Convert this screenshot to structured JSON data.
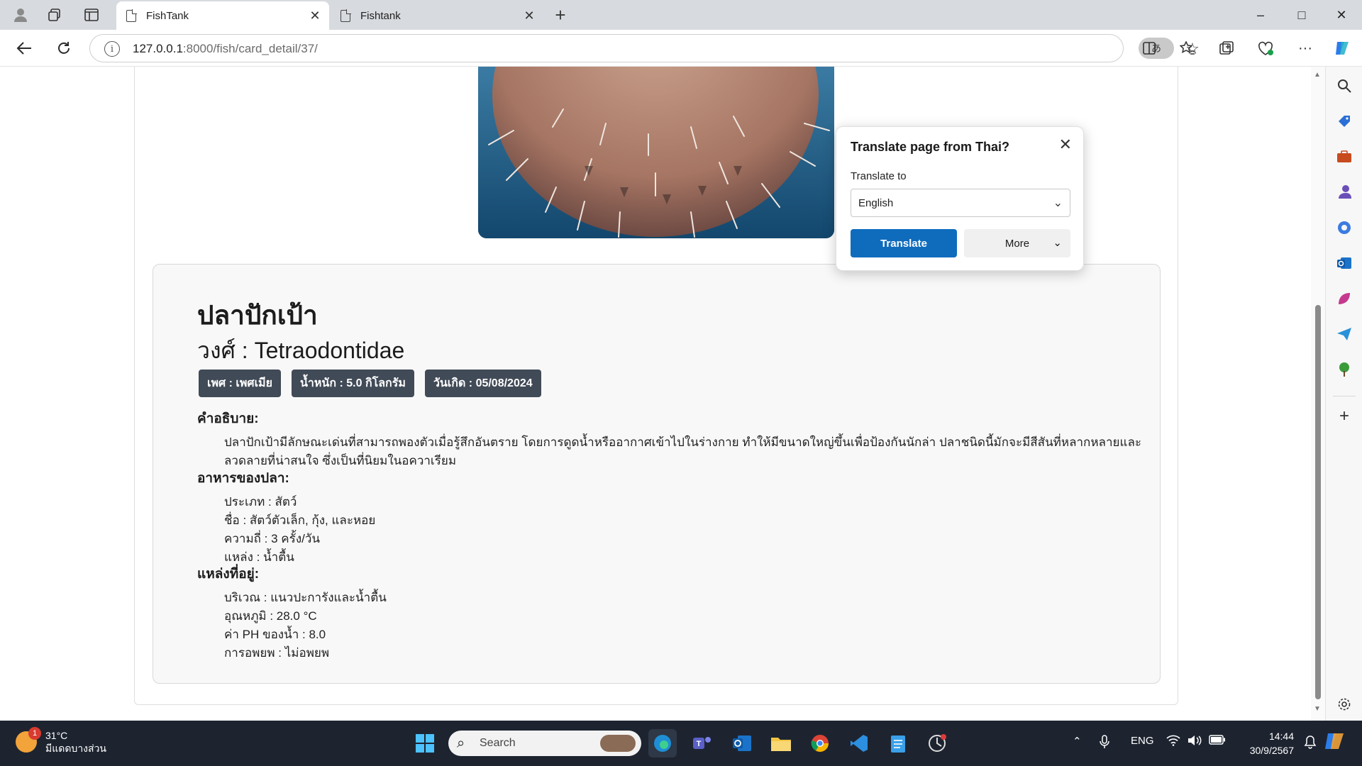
{
  "browser": {
    "tabs": [
      {
        "title": "FishTank",
        "active": true
      },
      {
        "title": "Fishtank",
        "active": false
      }
    ],
    "url_host": "127.0.0.1",
    "url_path": ":8000/fish/card_detail/37/",
    "translate_pill": "あ",
    "window_controls": {
      "minimize": "–",
      "maximize": "□",
      "close": "✕"
    }
  },
  "translate_popup": {
    "title": "Translate page from Thai?",
    "translate_to_label": "Translate to",
    "language": "English",
    "translate_button": "Translate",
    "more_button": "More"
  },
  "fish": {
    "name": "ปลาปักเป้า",
    "family": "วงศ์ : Tetraodontidae",
    "badges": [
      "เพศ : เพศเมีย",
      "น้ำหนัก : 5.0 กิโลกรัม",
      "วันเกิด : 05/08/2024"
    ],
    "description_title": "คำอธิบาย:",
    "description_lines": [
      "ปลาปักเป้ามีลักษณะเด่นที่สามารถพองตัวเมื่อรู้สึกอันตราย โดยการดูดน้ำหรืออากาศเข้าไปในร่างกาย ทำให้มีขนาดใหญ่ขึ้นเพื่อป้องกันนักล่า ปลาชนิดนี้มักจะมีสีสันที่หลากหลายและ",
      "ลวดลายที่น่าสนใจ ซึ่งเป็นที่นิยมในอควาเรียม"
    ],
    "food_title": "อาหารของปลา:",
    "food_lines": [
      "ประเภท : สัตว์",
      "ชื่อ : สัตว์ตัวเล็ก, กุ้ง, และหอย",
      "ความถี่ : 3 ครั้ง/วัน",
      "แหล่ง : น้ำตื้น"
    ],
    "habitat_title": "แหล่งที่อยู่:",
    "habitat_lines": [
      "บริเวณ : แนวปะการังและน้ำตื้น",
      "อุณหภูมิ : 28.0 °C",
      "ค่า PH ของน้ำ : 8.0",
      "การอพยพ : ไม่อพยพ"
    ]
  },
  "taskbar": {
    "weather_temp": "31°C",
    "weather_desc": "มีแดดบางส่วน",
    "weather_badge": "1",
    "search_placeholder": "Search",
    "language": "ENG",
    "time": "14:44",
    "date": "30/9/2567"
  },
  "colors": {
    "translate_button": "#0f6cbd",
    "badge_bg": "#414a57",
    "taskbar_bg": "#1d2430"
  }
}
